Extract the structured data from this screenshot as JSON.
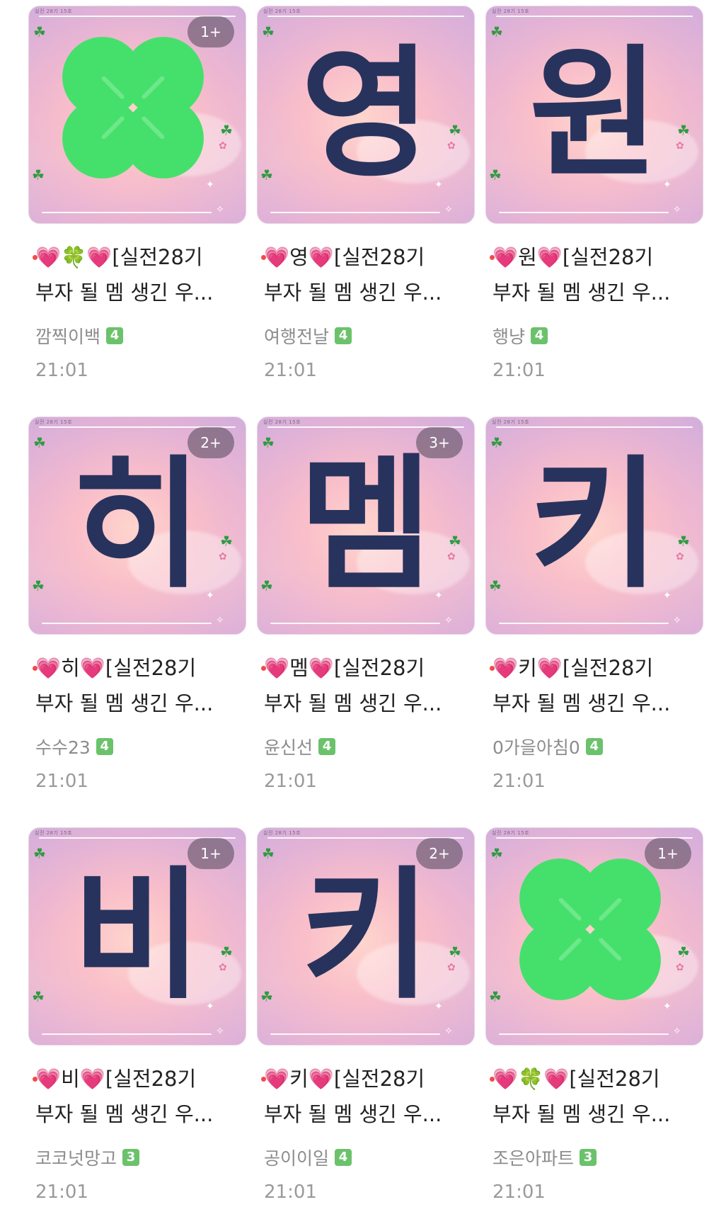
{
  "thumb_header_text": "실전 28기 15호",
  "colors": {
    "character": "#28335d",
    "clover": "#45e06b",
    "heart": "#f06aa8",
    "level_badge": "#6bc26b",
    "unread_dot": "#f04b4b"
  },
  "posts": [
    {
      "glyph": "clover",
      "badge": "1+",
      "title_line1": "💗🍀💗[실전28기",
      "title_line2": "부자 될 멤 생긴 우...",
      "author": "깜찍이백",
      "level": "4",
      "time": "21:01"
    },
    {
      "glyph": "영",
      "badge": "",
      "title_line1": "💗영💗[실전28기",
      "title_line2": "부자 될 멤 생긴 우...",
      "author": "여행전날",
      "level": "4",
      "time": "21:01"
    },
    {
      "glyph": "원",
      "badge": "",
      "title_line1": "💗원💗[실전28기",
      "title_line2": "부자 될 멤 생긴 우...",
      "author": "행냥",
      "level": "4",
      "time": "21:01"
    },
    {
      "glyph": "히",
      "badge": "2+",
      "title_line1": "💗히💗[실전28기",
      "title_line2": "부자 될 멤 생긴 우...",
      "author": "수수23",
      "level": "4",
      "time": "21:01"
    },
    {
      "glyph": "멤",
      "badge": "3+",
      "title_line1": "💗멤💗[실전28기",
      "title_line2": "부자 될 멤 생긴 우...",
      "author": "윤신선",
      "level": "4",
      "time": "21:01"
    },
    {
      "glyph": "키",
      "badge": "",
      "title_line1": "💗키💗[실전28기",
      "title_line2": "부자 될 멤 생긴 우...",
      "author": "0가을아침0",
      "level": "4",
      "time": "21:01"
    },
    {
      "glyph": "비",
      "badge": "1+",
      "title_line1": "💗비💗[실전28기",
      "title_line2": "부자 될 멤 생긴 우...",
      "author": "코코넛망고",
      "level": "3",
      "time": "21:01"
    },
    {
      "glyph": "키",
      "badge": "2+",
      "title_line1": "💗키💗[실전28기",
      "title_line2": "부자 될 멤 생긴 우...",
      "author": "공이이일",
      "level": "4",
      "time": "21:01"
    },
    {
      "glyph": "clover",
      "badge": "1+",
      "title_line1": "💗🍀💗[실전28기",
      "title_line2": "부자 될 멤 생긴 우...",
      "author": "조은아파트",
      "level": "3",
      "time": "21:01"
    }
  ]
}
